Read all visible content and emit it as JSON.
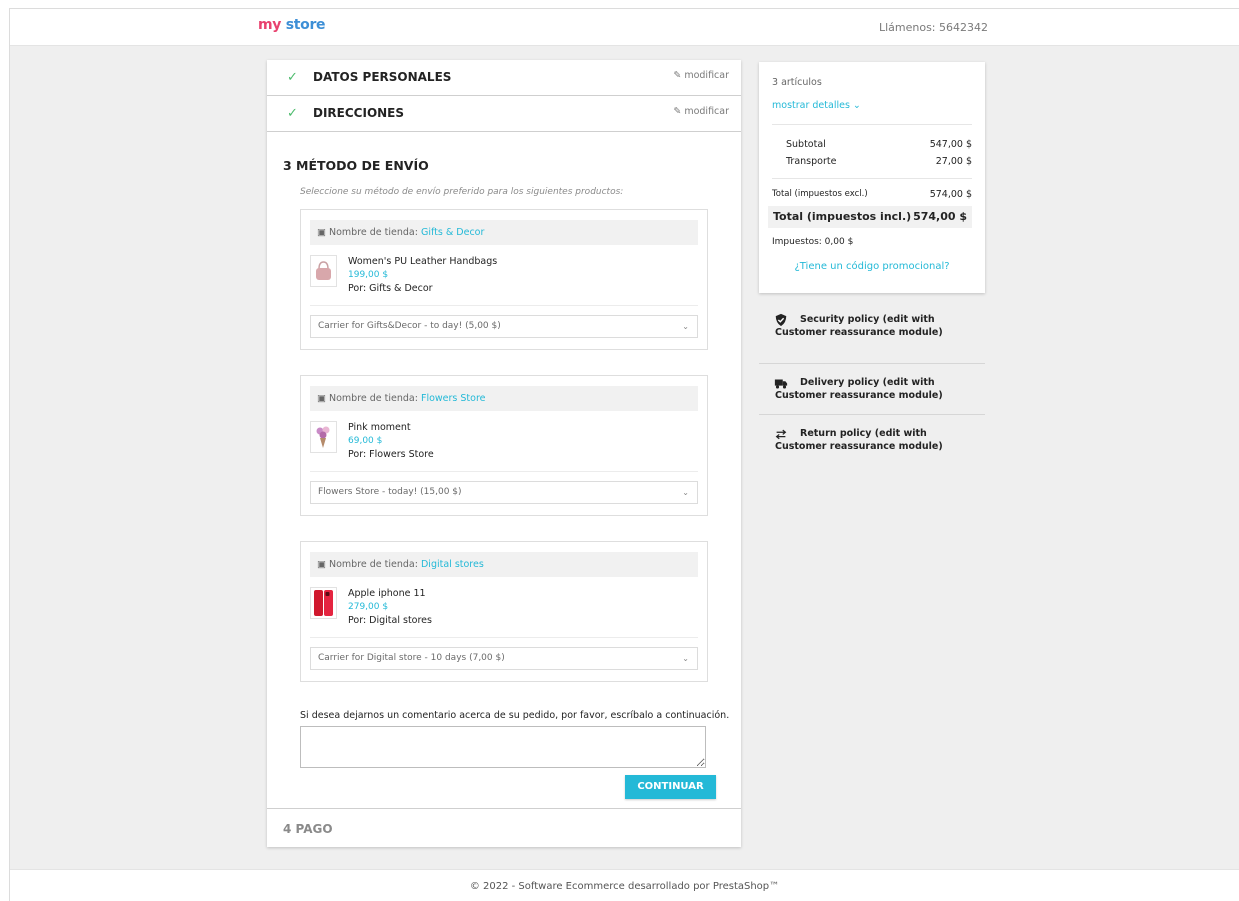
{
  "header": {
    "logo": {
      "part1": "my",
      "part2": "store"
    },
    "call_us": "Llámenos: 5642342"
  },
  "steps": [
    {
      "label": "DATOS PERSONALES",
      "edit": "modificar"
    },
    {
      "label": "DIRECCIONES",
      "edit": "modificar"
    }
  ],
  "current_step": {
    "label": "3  MÉTODO DE ENVÍO",
    "intro": "Seleccione su método de envío preferido para los siguientes productos:"
  },
  "store_label": "Nombre de tienda:",
  "sellers": [
    {
      "store": "Gifts & Decor",
      "product": "Women's PU Leather Handbags",
      "price": "199,00 $",
      "by": "Por: Gifts & Decor",
      "carrier": "Carrier for Gifts&Decor - to day! (5,00 $)"
    },
    {
      "store": "Flowers Store",
      "product": "Pink moment",
      "price": "69,00 $",
      "by": "Por: Flowers Store",
      "carrier": "Flowers Store - today! (15,00 $)"
    },
    {
      "store": "Digital stores",
      "product": "Apple iphone 11",
      "price": "279,00 $",
      "by": "Por: Digital stores",
      "carrier": "Carrier for Digital store - 10 days (7,00 $)"
    }
  ],
  "comment": {
    "label": "Si desea dejarnos un comentario acerca de su pedido, por favor, escríbalo a continuación.",
    "value": ""
  },
  "continue_button": "CONTINUAR",
  "payment_step": "4  PAGO",
  "summary": {
    "items_count": "3 artículos",
    "show_details": "mostrar detalles",
    "subtotal_label": "Subtotal",
    "subtotal_value": "547,00 $",
    "shipping_label": "Transporte",
    "shipping_value": "27,00 $",
    "total_excl_label": "Total (impuestos excl.)",
    "total_excl_value": "574,00 $",
    "total_incl_label": "Total (impuestos incl.)",
    "total_incl_value": "574,00 $",
    "taxes": "Impuestos: 0,00 $",
    "promo_link": "¿Tiene un código promocional?"
  },
  "reassurance": [
    {
      "icon": "shield-check-icon",
      "text": "Security policy (edit with Customer reassurance module)"
    },
    {
      "icon": "truck-icon",
      "text": "Delivery policy (edit with Customer reassurance module)"
    },
    {
      "icon": "return-arrows-icon",
      "text": "Return policy (edit with Customer reassurance module)"
    }
  ],
  "footer": "© 2022 - Software Ecommerce desarrollado por PrestaShop™",
  "colors": {
    "accent": "#24b9d7",
    "check": "#4cbb6c",
    "logo_pink": "#e8416e",
    "logo_orange": "#f5a623",
    "logo_blue": "#3d8fd6"
  }
}
